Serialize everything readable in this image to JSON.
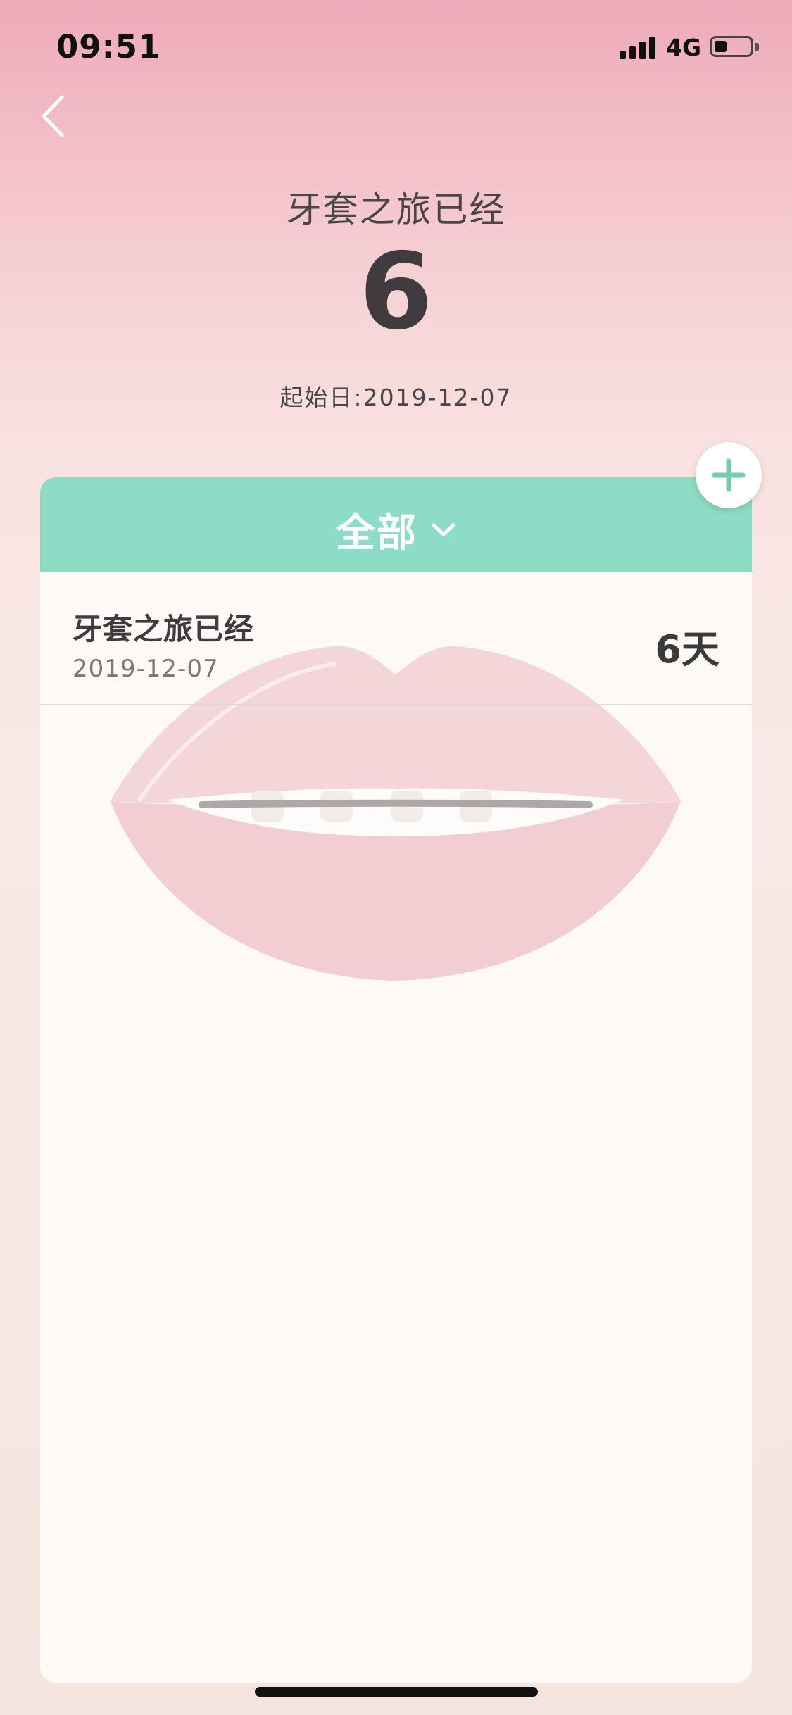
{
  "status_bar": {
    "time": "09:51",
    "network": "4G",
    "battery_level": 0.3,
    "icons": [
      "signal-icon",
      "battery-icon"
    ]
  },
  "nav": {
    "back_icon": "chevron-left-icon"
  },
  "header": {
    "title": "牙套之旅已经",
    "count": "6",
    "start_date_label": "起始日:",
    "start_date": "2019-12-07"
  },
  "filter": {
    "label": "全部",
    "icon": "chevron-down-icon",
    "color": "#8dddc6"
  },
  "add_button": {
    "icon": "plus-icon",
    "color": "#6fcfae"
  },
  "list": {
    "items": [
      {
        "title": "牙套之旅已经",
        "date": "2019-12-07",
        "days": "6天"
      }
    ]
  },
  "colors": {
    "accent": "#8dddc6",
    "background_top": "#eeaab9",
    "background_bottom": "#f6e5df"
  }
}
